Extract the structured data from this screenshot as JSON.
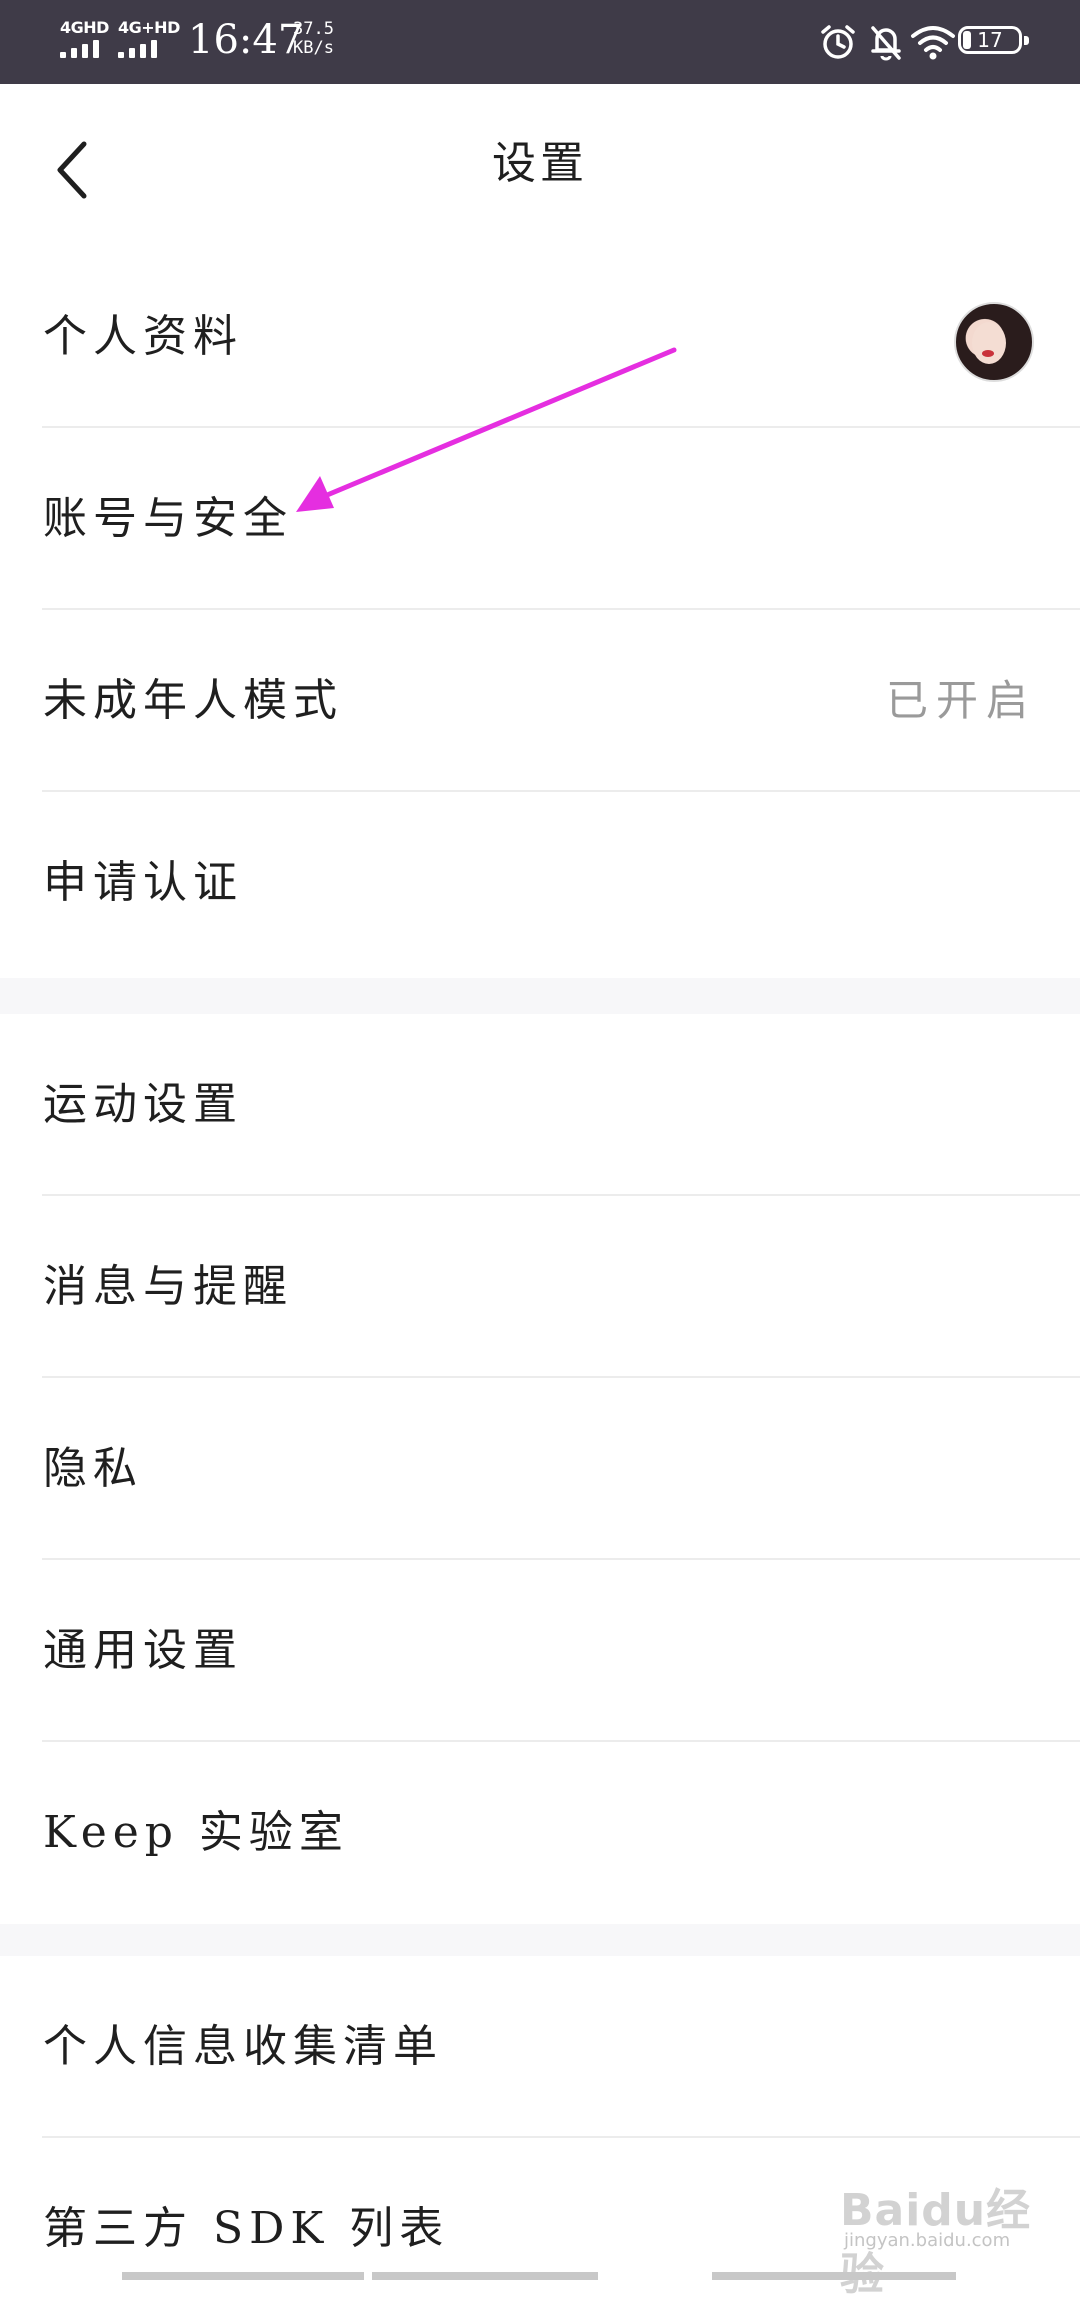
{
  "status_bar": {
    "sim1_label": "4GHD",
    "sim2_label": "4G+HD",
    "time": "16:47",
    "speed_value": "37.5",
    "speed_unit": "KB/s",
    "battery": "17",
    "icons": [
      "alarm-icon",
      "bell-off-icon",
      "wifi-icon",
      "battery-icon"
    ]
  },
  "header": {
    "title": "设置",
    "back_icon": "chevron-left-icon"
  },
  "section1": {
    "items": [
      {
        "label": "个人资料",
        "trailing": "avatar"
      },
      {
        "label": "账号与安全"
      },
      {
        "label": "未成年人模式",
        "value": "已开启"
      },
      {
        "label": "申请认证"
      }
    ]
  },
  "section2": {
    "items": [
      {
        "label": "运动设置"
      },
      {
        "label": "消息与提醒"
      },
      {
        "label": "隐私"
      },
      {
        "label": "通用设置"
      },
      {
        "label": "Keep 实验室"
      }
    ]
  },
  "section3": {
    "items": [
      {
        "label": "个人信息收集清单"
      },
      {
        "label": "第三方 SDK 列表"
      }
    ]
  },
  "annotation": {
    "type": "arrow",
    "color": "#e52ee0",
    "points_to": "账号与安全"
  },
  "watermark": {
    "brand": "Baidu经验",
    "url": "jingyan.baidu.com"
  },
  "colors": {
    "status_bar": "#3f3b48",
    "section_gap": "#f7f7f9",
    "divider": "#ececec",
    "value_text": "#9a9a9a"
  }
}
